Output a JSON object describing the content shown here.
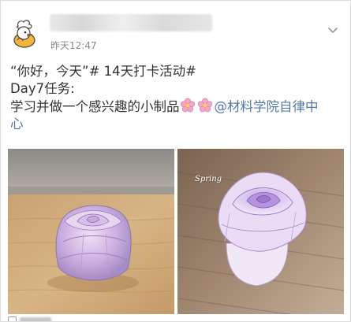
{
  "post": {
    "timestamp": "昨天12:47",
    "lines": {
      "line1": "“你好，今天”# 14天打卡活动#",
      "line2": "Day7任务:",
      "line3_text": "学习并做一个感兴趣的小制品",
      "line3_mention": "@材料学院自律中",
      "line4_mention": "心"
    }
  },
  "images": [
    {
      "alt_label": ""
    },
    {
      "overlay_text": "Spring"
    }
  ],
  "icons": {
    "avatar": "duck-chef-avatar-icon",
    "more": "chevron-down-icon",
    "emoji": "cherry-blossom-icon"
  },
  "colors": {
    "mention": "#5779a8",
    "text": "#333333",
    "timestamp": "#8a8a8a",
    "flower": "#e99ac0"
  }
}
